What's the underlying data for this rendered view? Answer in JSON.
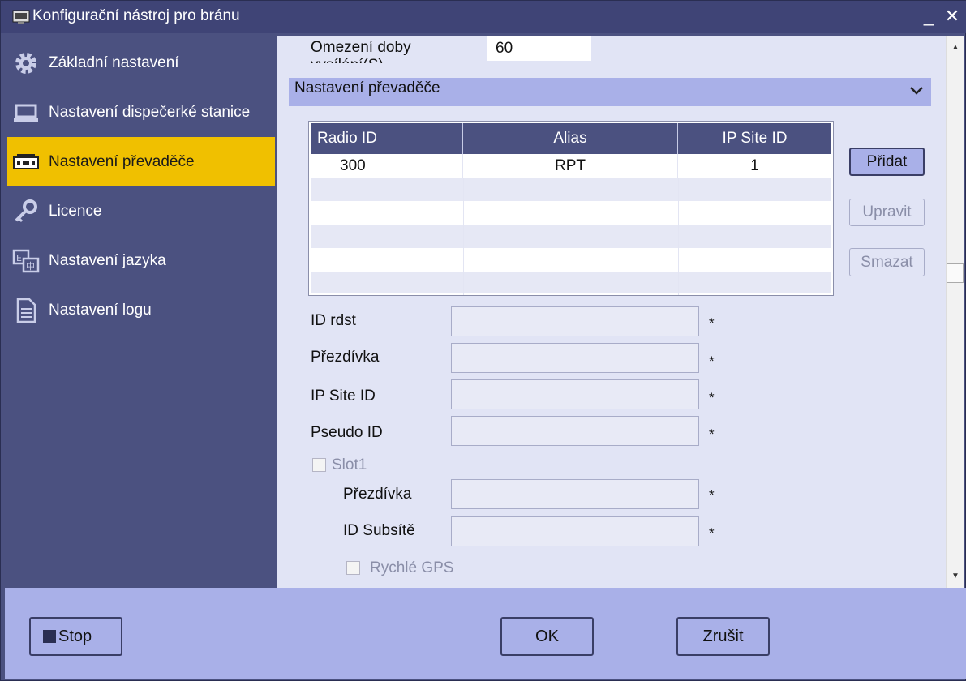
{
  "window": {
    "title": "Konfigurační nástroj pro bránu"
  },
  "sidebar": {
    "items": [
      {
        "label": "Základní nastavení",
        "icon": "gear-icon"
      },
      {
        "label": "Nastavení dispečerké stanice",
        "icon": "laptop-icon"
      },
      {
        "label": "Nastavení převaděče",
        "icon": "repeater-icon",
        "active": true
      },
      {
        "label": "Licence",
        "icon": "key-icon"
      },
      {
        "label": "Nastavení jazyka",
        "icon": "language-icon"
      },
      {
        "label": "Nastavení logu",
        "icon": "document-icon"
      }
    ]
  },
  "main": {
    "tx_limit_label": "Omezení doby vysílání(S)",
    "tx_limit_value": "60",
    "section_title": "Nastavení převaděče",
    "table": {
      "headers": [
        "Radio ID",
        "Alias",
        "IP Site ID"
      ],
      "rows": [
        [
          "300",
          "RPT",
          "1"
        ]
      ]
    },
    "buttons": {
      "add": "Přidat",
      "edit": "Upravit",
      "delete": "Smazat"
    },
    "fields": {
      "radio_id": "ID rdst",
      "nickname": "Přezdívka",
      "ip_site_id": "IP Site ID",
      "pseudo_id": "Pseudo ID",
      "required_mark": "*"
    },
    "slot1": {
      "label": "Slot1",
      "nickname": "Přezdívka",
      "subnet_id": "ID Subsítě",
      "fast_gps": "Rychlé GPS"
    }
  },
  "footer": {
    "stop": "Stop",
    "ok": "OK",
    "cancel": "Zrušit"
  },
  "colors": {
    "accent": "#f0c000",
    "sidebar": "#4b5180",
    "panel": "#e1e4f5",
    "header": "#a9b0e8"
  }
}
